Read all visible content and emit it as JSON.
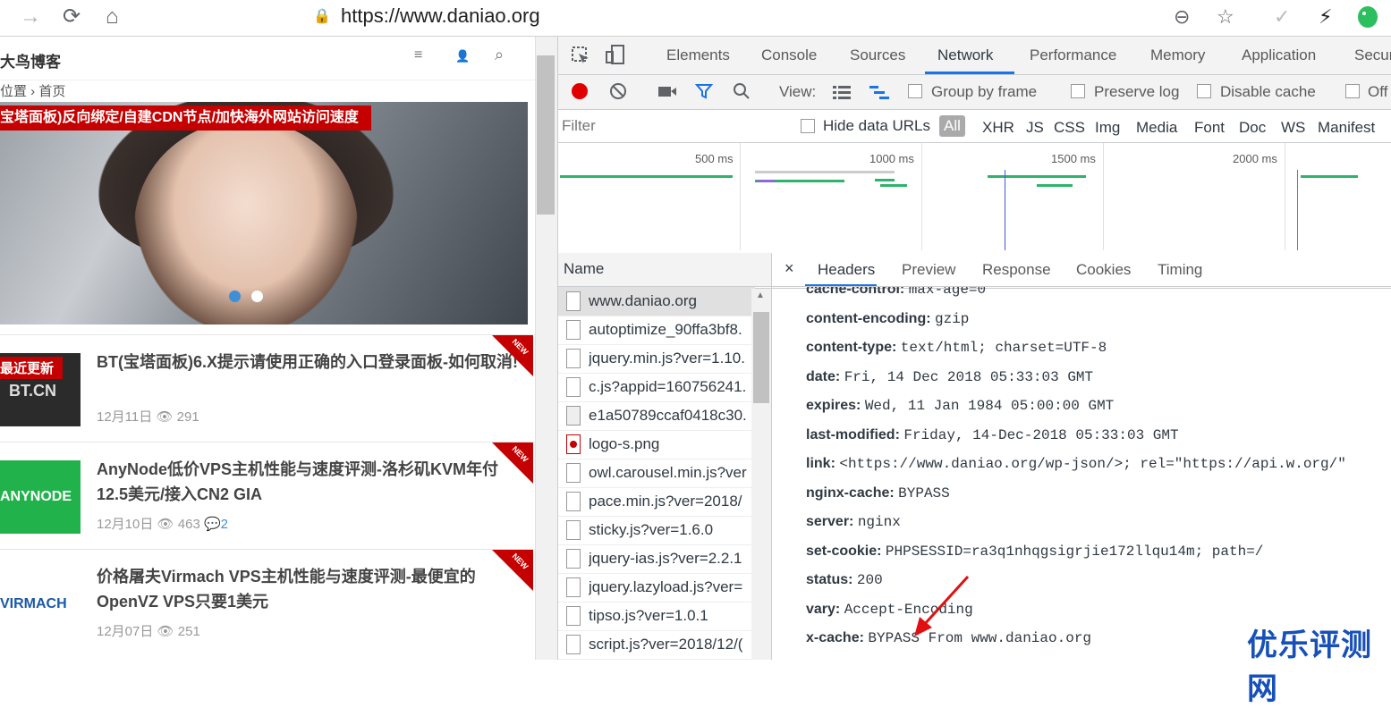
{
  "browser": {
    "url": "https://www.daniao.org",
    "forward_icon": "→",
    "reload_icon": "⟳",
    "home_icon": "⌂",
    "lock_icon": "🔒",
    "zoom_icon": "⊖",
    "star_icon": "☆",
    "check_icon": "✓",
    "bolt_icon": "⚡"
  },
  "site": {
    "title": "大鸟博客",
    "menu_icon": "≡",
    "user_icon": "👤",
    "search_icon": "⌕",
    "breadcrumb": "位置 › 首页",
    "hero_caption": "宝塔面板)反向绑定/自建CDN节点/加快海外网站访问速度",
    "posts": [
      {
        "thumb_text": "BT.CN",
        "badge": "最近更新",
        "title": "BT(宝塔面板)6.X提示请使用正确的入口登录面板-如何取消!",
        "date": "12月11日",
        "views": "291",
        "comments": "",
        "new_label": "NEW"
      },
      {
        "thumb_text": "ANYNODE",
        "badge": "",
        "title": "AnyNode低价VPS主机性能与速度评测-洛杉矶KVM年付12.5美元/接入CN2 GIA",
        "date": "12月10日",
        "views": "463",
        "comments": "2",
        "new_label": "NEW"
      },
      {
        "thumb_text": "VIRMACH",
        "badge": "",
        "title": "价格屠夫Virmach VPS主机性能与速度评测-最便宜的OpenVZ VPS只要1美元",
        "date": "12月07日",
        "views": "251",
        "comments": "",
        "new_label": "NEW"
      }
    ]
  },
  "devtools": {
    "tabs": [
      "Elements",
      "Console",
      "Sources",
      "Network",
      "Performance",
      "Memory",
      "Application",
      "Secur"
    ],
    "toolbar": {
      "view_label": "View:",
      "group_by_frame": "Group by frame",
      "preserve_log": "Preserve log",
      "disable_cache": "Disable cache",
      "offline": "Off"
    },
    "filter": {
      "placeholder": "Filter",
      "hide_data_urls": "Hide data URLs",
      "types": [
        "All",
        "XHR",
        "JS",
        "CSS",
        "Img",
        "Media",
        "Font",
        "Doc",
        "WS",
        "Manifest"
      ]
    },
    "timeline_ticks": [
      "500 ms",
      "1000 ms",
      "1500 ms",
      "2000 ms"
    ],
    "name_header": "Name",
    "requests": [
      "www.daniao.org",
      "autoptimize_90ffa3bf8.",
      "jquery.min.js?ver=1.10.",
      "c.js?appid=160756241.",
      "e1a50789ccaf0418c30.",
      "logo-s.png",
      "owl.carousel.min.js?ver",
      "pace.min.js?ver=2018/",
      "sticky.js?ver=1.6.0",
      "jquery-ias.js?ver=2.2.1",
      "jquery.lazyload.js?ver=",
      "tipso.js?ver=1.0.1",
      "script.js?ver=2018/12/("
    ],
    "detail_close": "×",
    "detail_tabs": [
      "Headers",
      "Preview",
      "Response",
      "Cookies",
      "Timing"
    ],
    "headers": [
      {
        "key": "cache-control:",
        "value": "max-age=0"
      },
      {
        "key": "content-encoding:",
        "value": "gzip"
      },
      {
        "key": "content-type:",
        "value": "text/html; charset=UTF-8"
      },
      {
        "key": "date:",
        "value": "Fri, 14 Dec 2018 05:33:03 GMT"
      },
      {
        "key": "expires:",
        "value": "Wed, 11 Jan 1984 05:00:00 GMT"
      },
      {
        "key": "last-modified:",
        "value": "Friday, 14-Dec-2018 05:33:03 GMT"
      },
      {
        "key": "link:",
        "value": "<https://www.daniao.org/wp-json/>; rel=\"https://api.w.org/\""
      },
      {
        "key": "nginx-cache:",
        "value": "BYPASS"
      },
      {
        "key": "server:",
        "value": "nginx"
      },
      {
        "key": "set-cookie:",
        "value": "PHPSESSID=ra3q1nhqgsigrjie172llqu14m; path=/"
      },
      {
        "key": "status:",
        "value": "200"
      },
      {
        "key": "vary:",
        "value": "Accept-Encoding"
      },
      {
        "key": "x-cache:",
        "value": "BYPASS From www.daniao.org"
      }
    ]
  },
  "watermark": "优乐评测网",
  "colors": {
    "accent": "#1a73e8",
    "record": "#e00000",
    "site_red": "#c40000",
    "arrow": "#e01010"
  }
}
